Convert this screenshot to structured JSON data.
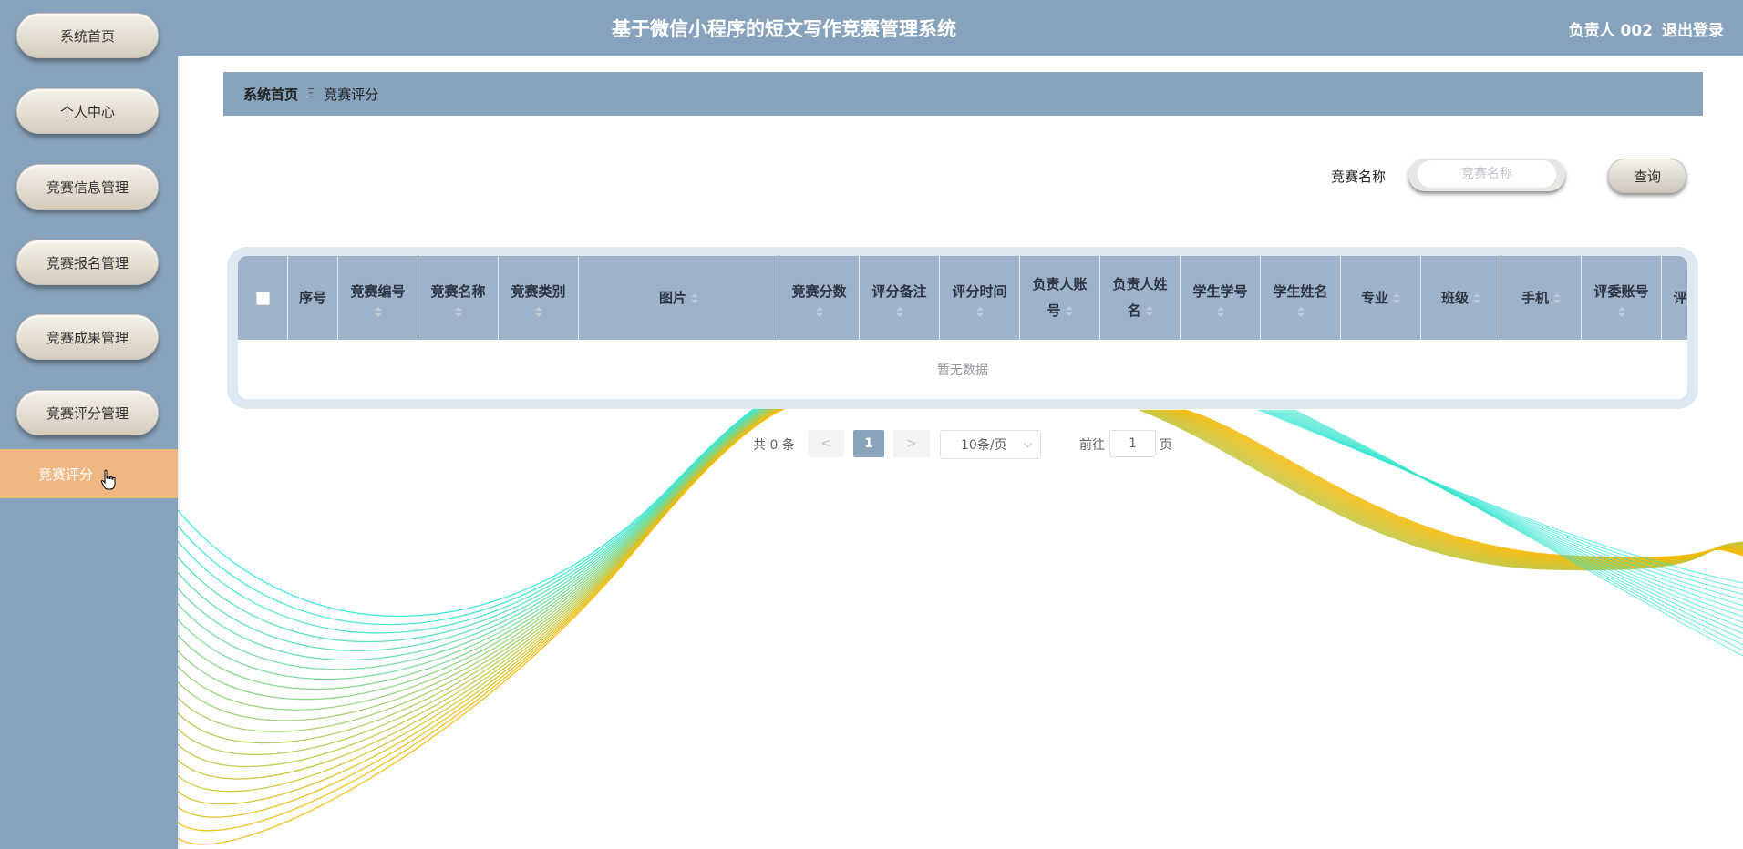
{
  "app": {
    "title": "基于微信小程序的短文写作竞赛管理系统",
    "user": "负责人 002",
    "logout": "退出登录"
  },
  "sidebar": {
    "items": [
      {
        "label": "系统首页"
      },
      {
        "label": "个人中心"
      },
      {
        "label": "竞赛信息管理"
      },
      {
        "label": "竞赛报名管理"
      },
      {
        "label": "竞赛成果管理"
      },
      {
        "label": "竞赛评分管理"
      }
    ],
    "active_sub": "竞赛评分"
  },
  "breadcrumb": {
    "home": "系统首页",
    "separator": "Ξ",
    "current": "竞赛评分"
  },
  "search": {
    "label": "竞赛名称",
    "placeholder": "竞赛名称",
    "value": "",
    "button": "查询"
  },
  "table": {
    "columns": [
      {
        "line1": "",
        "line2": "",
        "sortable": false,
        "checkbox": true
      },
      {
        "line1": "序号",
        "line2": "",
        "sortable": false
      },
      {
        "line1": "竞赛编号",
        "line2": "",
        "sortable": true,
        "sort_below": true
      },
      {
        "line1": "竞赛名称",
        "line2": "",
        "sortable": true,
        "sort_below": true
      },
      {
        "line1": "竞赛类别",
        "line2": "",
        "sortable": true,
        "sort_below": true
      },
      {
        "line1": "图片",
        "line2": "",
        "sortable": true,
        "sort_below": false
      },
      {
        "line1": "竞赛分数",
        "line2": "",
        "sortable": true,
        "sort_below": true
      },
      {
        "line1": "评分备注",
        "line2": "",
        "sortable": true,
        "sort_below": true
      },
      {
        "line1": "评分时间",
        "line2": "",
        "sortable": true,
        "sort_below": true
      },
      {
        "line1": "负责人账",
        "line2": "号",
        "sortable": true,
        "sort_below": false
      },
      {
        "line1": "负责人姓",
        "line2": "名",
        "sortable": true,
        "sort_below": false
      },
      {
        "line1": "学生学号",
        "line2": "",
        "sortable": true,
        "sort_below": true
      },
      {
        "line1": "学生姓名",
        "line2": "",
        "sortable": true,
        "sort_below": true
      },
      {
        "line1": "专业",
        "line2": "",
        "sortable": true,
        "sort_below": false
      },
      {
        "line1": "班级",
        "line2": "",
        "sortable": true,
        "sort_below": false
      },
      {
        "line1": "手机",
        "line2": "",
        "sortable": true,
        "sort_below": false
      },
      {
        "line1": "评委账号",
        "line2": "",
        "sortable": true,
        "sort_below": true
      },
      {
        "line1": "评",
        "line2": "",
        "sortable": false
      }
    ],
    "empty_text": "暂无数据"
  },
  "pagination": {
    "total": "共 0 条",
    "prev": "<",
    "next": ">",
    "current_page": "1",
    "page_size": "10条/页",
    "goto_label": "前往",
    "goto_value": "1",
    "goto_unit": "页"
  },
  "colors": {
    "primary": "#87a2bc",
    "active": "#efb782",
    "table_header": "#9eb2c9",
    "wave_cyan": "#2ee6d6",
    "wave_yellow": "#f5b800"
  }
}
